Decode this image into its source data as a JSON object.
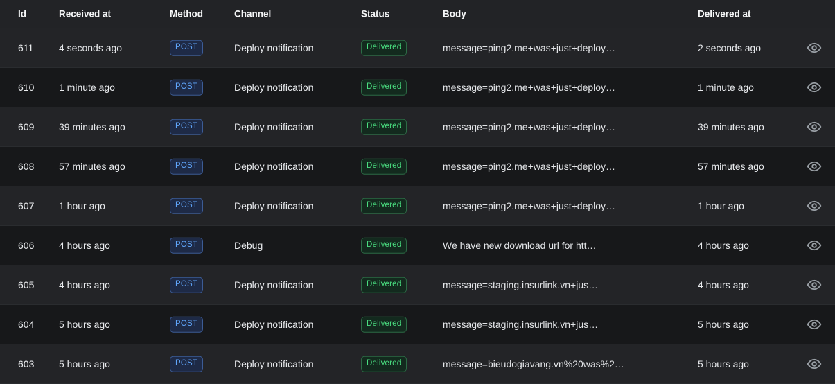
{
  "table": {
    "columns": [
      {
        "key": "id",
        "label": "Id"
      },
      {
        "key": "received_at",
        "label": "Received at"
      },
      {
        "key": "method",
        "label": "Method"
      },
      {
        "key": "channel",
        "label": "Channel"
      },
      {
        "key": "status",
        "label": "Status"
      },
      {
        "key": "body",
        "label": "Body"
      },
      {
        "key": "delivered_at",
        "label": "Delivered at"
      },
      {
        "key": "actions",
        "label": ""
      }
    ],
    "action_icon": "eye-icon",
    "colors": {
      "page_background": "#1b1c1f",
      "header_background": "#222326",
      "row_odd_background": "#232427",
      "row_even_background": "#17181a",
      "row_border": "#2a2c2f",
      "text_primary": "#e8eaed",
      "method_badge_text": "#60a5fa",
      "method_badge_border": "#3c5c96",
      "method_badge_background": "#1e2a46",
      "status_badge_text": "#4ade80",
      "status_badge_border": "#2c6b45",
      "status_badge_background": "#132a1e",
      "action_icon": "#9aa0a6"
    },
    "rows": [
      {
        "id": "611",
        "received_at": "4 seconds ago",
        "method": "POST",
        "channel": "Deploy notification",
        "status": "Delivered",
        "body": "message=ping2.me+was+just+deploy…",
        "delivered_at": "2 seconds ago"
      },
      {
        "id": "610",
        "received_at": "1 minute ago",
        "method": "POST",
        "channel": "Deploy notification",
        "status": "Delivered",
        "body": "message=ping2.me+was+just+deploy…",
        "delivered_at": "1 minute ago"
      },
      {
        "id": "609",
        "received_at": "39 minutes ago",
        "method": "POST",
        "channel": "Deploy notification",
        "status": "Delivered",
        "body": "message=ping2.me+was+just+deploy…",
        "delivered_at": "39 minutes ago"
      },
      {
        "id": "608",
        "received_at": "57 minutes ago",
        "method": "POST",
        "channel": "Deploy notification",
        "status": "Delivered",
        "body": "message=ping2.me+was+just+deploy…",
        "delivered_at": "57 minutes ago"
      },
      {
        "id": "607",
        "received_at": "1 hour ago",
        "method": "POST",
        "channel": "Deploy notification",
        "status": "Delivered",
        "body": "message=ping2.me+was+just+deploy…",
        "delivered_at": "1 hour ago"
      },
      {
        "id": "606",
        "received_at": "4 hours ago",
        "method": "POST",
        "channel": "Debug",
        "status": "Delivered",
        "body": "We have new download url for htt…",
        "delivered_at": "4 hours ago"
      },
      {
        "id": "605",
        "received_at": "4 hours ago",
        "method": "POST",
        "channel": "Deploy notification",
        "status": "Delivered",
        "body": "message=staging.insurlink.vn+jus…",
        "delivered_at": "4 hours ago"
      },
      {
        "id": "604",
        "received_at": "5 hours ago",
        "method": "POST",
        "channel": "Deploy notification",
        "status": "Delivered",
        "body": "message=staging.insurlink.vn+jus…",
        "delivered_at": "5 hours ago"
      },
      {
        "id": "603",
        "received_at": "5 hours ago",
        "method": "POST",
        "channel": "Deploy notification",
        "status": "Delivered",
        "body": "message=bieudogiavang.vn%20was%2…",
        "delivered_at": "5 hours ago"
      }
    ]
  }
}
